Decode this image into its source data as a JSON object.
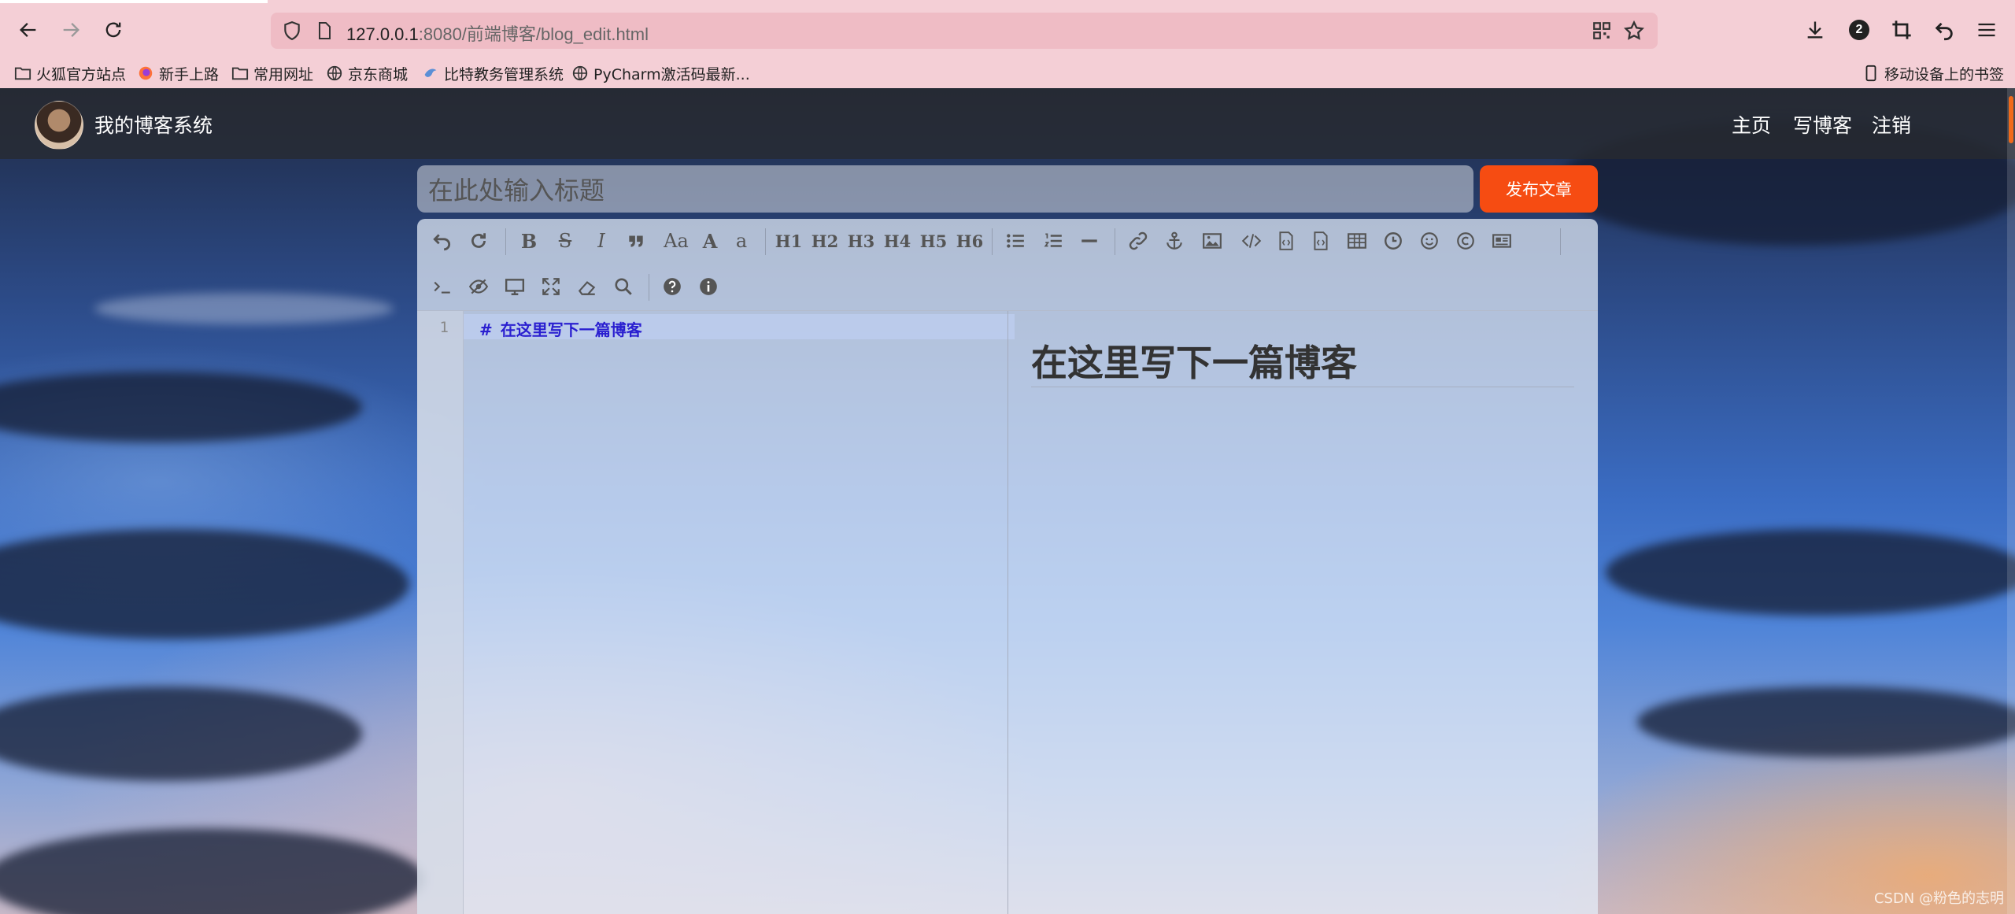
{
  "browser": {
    "url_host": "127.0.0.1",
    "url_rest": ":8080/前端博客/blog_edit.html",
    "downloads_badge": "2",
    "bookmarks": [
      {
        "icon": "folder-icon",
        "label": "火狐官方站点"
      },
      {
        "icon": "firefox-icon",
        "label": "新手上路"
      },
      {
        "icon": "folder-icon",
        "label": "常用网址"
      },
      {
        "icon": "globe-icon",
        "label": "京东商城"
      },
      {
        "icon": "bird-icon",
        "label": "比特教务管理系统"
      },
      {
        "icon": "globe-icon",
        "label": "PyCharm激活码最新..."
      }
    ],
    "mobile_bookmarks": "移动设备上的书签"
  },
  "site": {
    "title": "我的博客系统",
    "nav": [
      "主页",
      "写博客",
      "注销"
    ]
  },
  "editor": {
    "title_placeholder": "在此处输入标题",
    "publish_label": "发布文章",
    "toolbar": {
      "headings": [
        "H1",
        "H2",
        "H3",
        "H4",
        "H5",
        "H6"
      ],
      "case_upper": "Aa",
      "case_a": "A",
      "case_lower": "a"
    },
    "line_number": "1",
    "code_hash": "#",
    "code_line": "在这里写下一篇博客",
    "preview_heading": "在这里写下一篇博客"
  },
  "watermark": "CSDN @粉色的志明",
  "colors": {
    "publish": "#f64c12",
    "navbar": "#282a30",
    "code_text": "#2a1fd0"
  }
}
